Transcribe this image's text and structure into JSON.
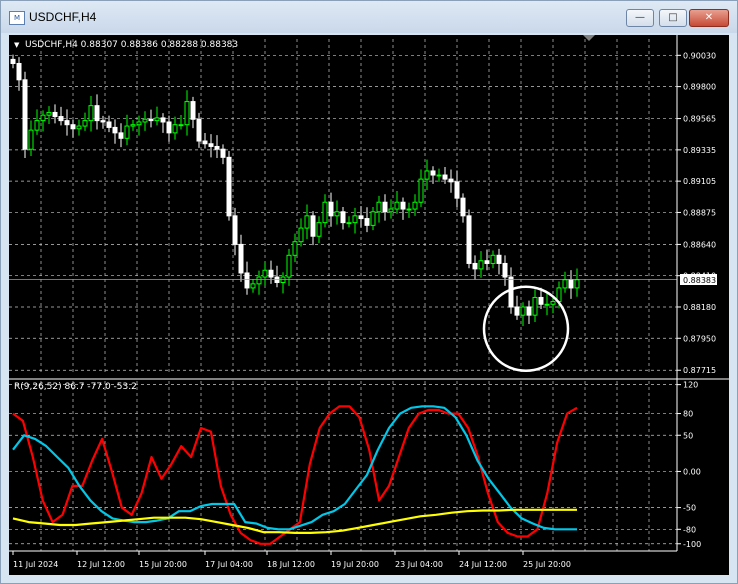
{
  "window": {
    "title": "USDCHF,H4",
    "icon_glyph": "M",
    "buttons": {
      "minimize_glyph": "—",
      "restore_glyph": "□",
      "close_glyph": "✕"
    }
  },
  "chart_data": [
    {
      "type": "candlestick",
      "title": "USDCHF,H4  0.88307 0.88386 0.88288 0.88383",
      "title_glyph": "▼",
      "ylim": [
        0.8768,
        0.9015
      ],
      "yticks": [
        "0.90030",
        "0.89800",
        "0.89565",
        "0.89335",
        "0.89105",
        "0.88875",
        "0.88640",
        "0.88410",
        "0.88180",
        "0.87950",
        "0.87715"
      ],
      "current_price": "0.88383",
      "grid": true,
      "up_color": "#00ff00",
      "down_color": "#ffffff",
      "annotation": {
        "shape": "circle",
        "color": "#ffffff"
      },
      "close": [
        0.8997,
        0.8985,
        0.8934,
        0.8948,
        0.8955,
        0.8959,
        0.8961,
        0.8958,
        0.8955,
        0.8952,
        0.8949,
        0.8951,
        0.8955,
        0.8966,
        0.8955,
        0.8954,
        0.895,
        0.8946,
        0.8942,
        0.8951,
        0.8952,
        0.8954,
        0.8956,
        0.8955,
        0.8957,
        0.8954,
        0.8946,
        0.8952,
        0.8952,
        0.8969,
        0.8956,
        0.894,
        0.8938,
        0.8936,
        0.8934,
        0.8928,
        0.8885,
        0.8864,
        0.8843,
        0.8832,
        0.8835,
        0.884,
        0.8845,
        0.884,
        0.8836,
        0.884,
        0.8856,
        0.8866,
        0.8876,
        0.8885,
        0.887,
        0.888,
        0.8895,
        0.8885,
        0.8888,
        0.888,
        0.888,
        0.8885,
        0.8883,
        0.8878,
        0.8888,
        0.8895,
        0.8888,
        0.889,
        0.8895,
        0.889,
        0.889,
        0.8895,
        0.8912,
        0.8918,
        0.8915,
        0.8915,
        0.8912,
        0.891,
        0.8898,
        0.8885,
        0.885,
        0.8846,
        0.8852,
        0.885,
        0.8856,
        0.885,
        0.884,
        0.8818,
        0.8812,
        0.8818,
        0.8812,
        0.8825,
        0.882,
        0.882,
        0.8822,
        0.8832,
        0.8838,
        0.8832,
        0.8838
      ]
    },
    {
      "type": "line",
      "title": "R(9,26,52) 86.7 -77.0 -53.2",
      "ylim": [
        -110,
        125
      ],
      "yticks": [
        "120",
        "80",
        "50",
        "0.00",
        "-50",
        "-80",
        "-100"
      ],
      "grid": true,
      "series": [
        {
          "color": "#ff0000",
          "values": [
            80,
            70,
            20,
            -40,
            -70,
            -60,
            -20,
            -20,
            15,
            45,
            0,
            -50,
            -60,
            -30,
            20,
            -10,
            10,
            35,
            20,
            60,
            55,
            -20,
            -60,
            -85,
            -95,
            -100,
            -100,
            -90,
            -80,
            -70,
            10,
            60,
            80,
            90,
            90,
            75,
            30,
            -40,
            -20,
            20,
            60,
            80,
            85,
            85,
            80,
            80,
            60,
            20,
            -30,
            -70,
            -85,
            -90,
            -90,
            -80,
            -30,
            40,
            80,
            88
          ]
        },
        {
          "color": "#00c8e8",
          "values": [
            30,
            50,
            45,
            35,
            20,
            5,
            -20,
            -40,
            -55,
            -65,
            -68,
            -70,
            -70,
            -68,
            -65,
            -55,
            -55,
            -48,
            -45,
            -45,
            -45,
            -70,
            -72,
            -78,
            -80,
            -80,
            -75,
            -70,
            -60,
            -55,
            -45,
            -25,
            -5,
            30,
            60,
            80,
            88,
            90,
            90,
            88,
            75,
            50,
            15,
            -10,
            -30,
            -50,
            -65,
            -72,
            -78,
            -80,
            -80,
            -80
          ]
        },
        {
          "color": "#ffff00",
          "values": [
            -65,
            -70,
            -72,
            -74,
            -74,
            -72,
            -70,
            -68,
            -66,
            -64,
            -64,
            -64,
            -66,
            -70,
            -74,
            -78,
            -84,
            -84,
            -85,
            -85,
            -84,
            -82,
            -78,
            -74,
            -70,
            -66,
            -62,
            -60,
            -57,
            -55,
            -54,
            -54,
            -53,
            -53,
            -53,
            -53,
            -53
          ]
        }
      ]
    }
  ],
  "xaxis": {
    "labels": [
      "11 Jul 2024",
      "12 Jul 12:00",
      "15 Jul 20:00",
      "17 Jul 04:00",
      "18 Jul 12:00",
      "19 Jul 20:00",
      "23 Jul 04:00",
      "24 Jul 12:00",
      "25 Jul 20:00"
    ]
  }
}
